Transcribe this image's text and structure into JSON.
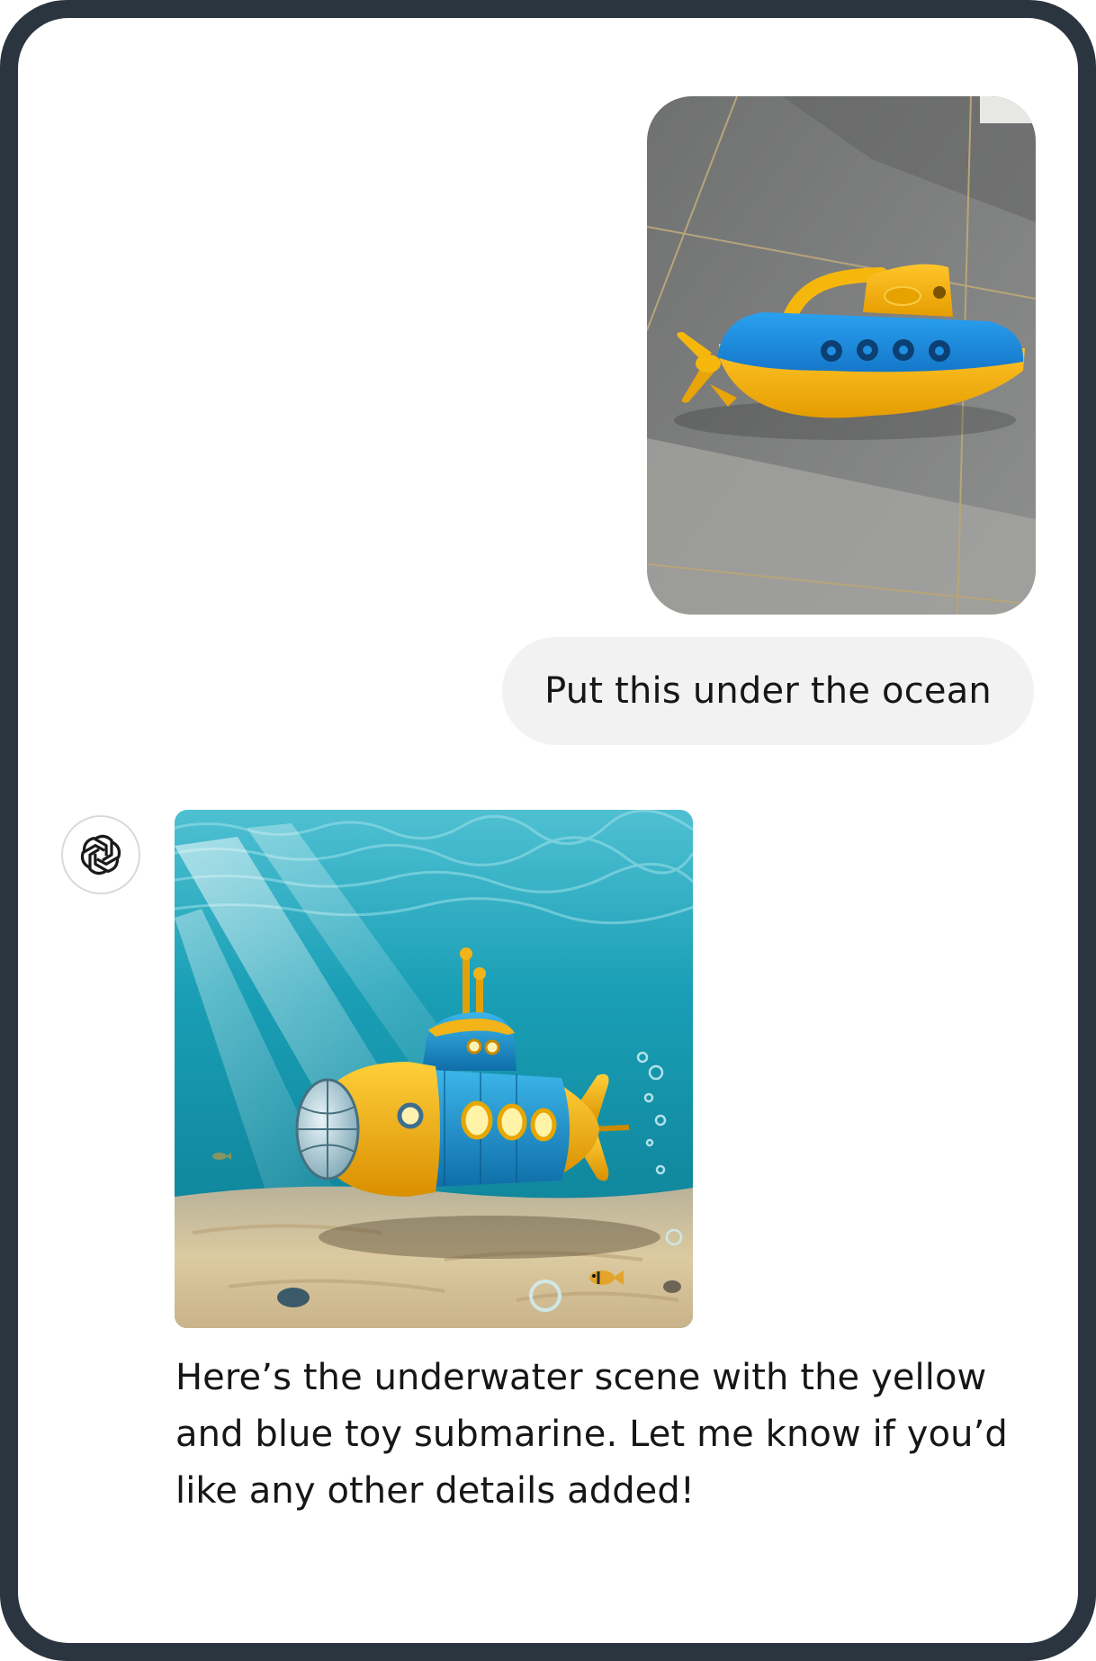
{
  "conversation": {
    "user": {
      "photo": {
        "icon": "toy-submarine-photo",
        "colors": {
          "tile": "#7d7e7e",
          "hull_blue": "#1f8fe0",
          "hull_yellow": "#f6b70d"
        }
      },
      "message": "Put this under the ocean"
    },
    "assistant": {
      "avatar_icon": "openai-logo-icon",
      "image": {
        "icon": "underwater-submarine-image",
        "colors": {
          "water": "#1aa3b8",
          "sand": "#d7c39a",
          "hull_yellow": "#f2b418",
          "hull_blue": "#1e9bd6"
        }
      },
      "message": "Here’s the underwater scene with the yellow and blue toy submarine. Let me know if you’d like any other details added!"
    }
  }
}
